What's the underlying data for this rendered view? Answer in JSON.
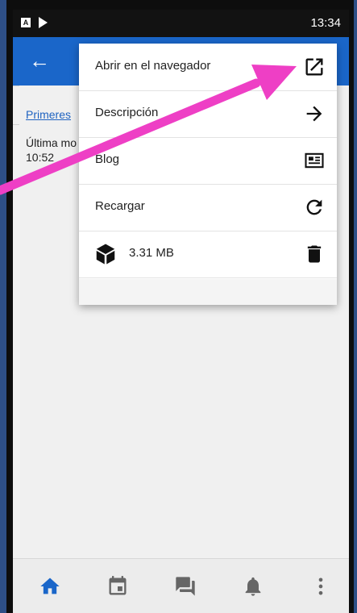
{
  "statusbar": {
    "time": "13:34",
    "notif_letter": "A"
  },
  "page": {
    "link_text": "Primeres",
    "meta_line1": "Última mo",
    "meta_line2": "10:52"
  },
  "menu": {
    "items": [
      {
        "label": "Abrir en el navegador",
        "icon": "open-in-new-icon"
      },
      {
        "label": "Descripción",
        "icon": "arrow-right-icon"
      },
      {
        "label": "Blog",
        "icon": "newspaper-icon"
      },
      {
        "label": "Recargar",
        "icon": "reload-icon"
      },
      {
        "label": "3.31 MB",
        "lead_icon": "package-icon",
        "icon": "trash-icon"
      }
    ]
  },
  "bottomnav": {
    "items": [
      "home-icon",
      "calendar-icon",
      "forum-icon",
      "bell-icon",
      "more-vertical-icon"
    ],
    "active": "home-icon"
  },
  "colors": {
    "appbar": "#1a66c9",
    "active_nav": "#1a66c9",
    "annotation_arrow": "#ee3fc5"
  }
}
